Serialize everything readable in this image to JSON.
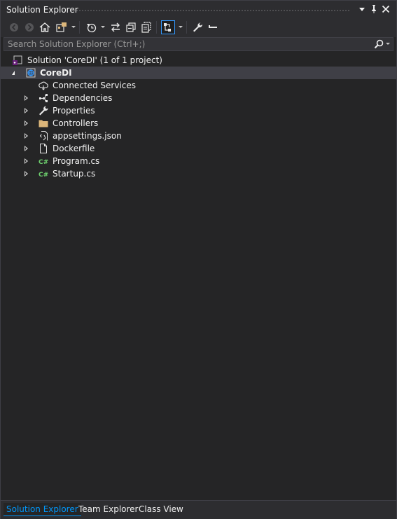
{
  "window": {
    "title": "Solution Explorer",
    "accent_color": "#3399ff"
  },
  "toolbar": {
    "buttons": [
      {
        "icon": "back-arrow-icon"
      },
      {
        "icon": "forward-arrow-icon"
      },
      {
        "icon": "home-icon"
      },
      {
        "icon": "switch-views-icon"
      },
      {
        "icon": "pending-changes-filter-icon"
      },
      {
        "icon": "sync-with-active-document-icon"
      },
      {
        "icon": "collapse-all-icon"
      },
      {
        "icon": "show-all-files-icon"
      },
      {
        "icon": "preview-selected-items-icon"
      },
      {
        "icon": "properties-wrench-icon"
      },
      {
        "icon": "pin-bar-icon"
      }
    ]
  },
  "search": {
    "placeholder": "Search Solution Explorer (Ctrl+;)"
  },
  "tree": {
    "solution_label": "Solution 'CoreDI' (1 of 1 project)",
    "project_label": "CoreDI",
    "items": [
      {
        "label": "Connected Services",
        "icon": "connected-services-icon",
        "expandable": false
      },
      {
        "label": "Dependencies",
        "icon": "dependencies-icon",
        "expandable": true
      },
      {
        "label": "Properties",
        "icon": "wrench-icon",
        "expandable": true
      },
      {
        "label": "Controllers",
        "icon": "folder-icon",
        "expandable": true
      },
      {
        "label": "appsettings.json",
        "icon": "json-file-icon",
        "expandable": true
      },
      {
        "label": "Dockerfile",
        "icon": "file-icon",
        "expandable": true
      },
      {
        "label": "Program.cs",
        "icon": "csharp-file-icon",
        "expandable": true
      },
      {
        "label": "Startup.cs",
        "icon": "csharp-file-icon",
        "expandable": true
      }
    ]
  },
  "tabs": [
    {
      "label": "Solution Explorer",
      "active": true
    },
    {
      "label": "Team Explorer",
      "active": false
    },
    {
      "label": "Class View",
      "active": false
    }
  ]
}
